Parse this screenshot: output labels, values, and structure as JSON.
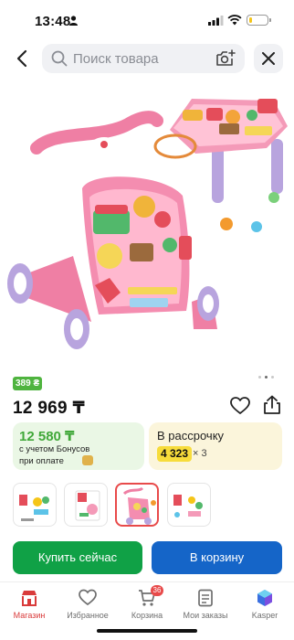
{
  "status_bar": {
    "time": "13:48",
    "battery_level": 0.2,
    "battery_color": "#f5c518"
  },
  "search": {
    "placeholder": "Поиск товара",
    "value": ""
  },
  "product": {
    "price_badge": "389 ₴",
    "price": "12 969 ₸",
    "gallery_dots": {
      "count": 3,
      "active": 1
    }
  },
  "bonus_card": {
    "amount": "12 580 ₸",
    "line1": "с учетом Бонусов",
    "line2": "при оплате"
  },
  "installment_card": {
    "title": "В рассрочку",
    "amount": "4 323",
    "multiplier": "× 3"
  },
  "thumbnails": {
    "count": 4,
    "selected_index": 2
  },
  "actions": {
    "buy_now": "Купить сейчас",
    "add_to_cart": "В корзину"
  },
  "tabbar": {
    "items": [
      {
        "label": "Магазин",
        "icon": "shop-icon",
        "active": true
      },
      {
        "label": "Избранное",
        "icon": "heart-icon",
        "active": false
      },
      {
        "label": "Корзина",
        "icon": "cart-icon",
        "active": false,
        "badge": "36"
      },
      {
        "label": "Мои заказы",
        "icon": "orders-icon",
        "active": false
      },
      {
        "label": "Kasper",
        "icon": "kasper-icon",
        "active": false
      }
    ]
  },
  "colors": {
    "accent_red": "#e84a4a",
    "buy_green": "#10a146",
    "cart_blue": "#1565c8",
    "bonus_green": "#41a83a",
    "installment_yellow": "#f7dc3b"
  }
}
